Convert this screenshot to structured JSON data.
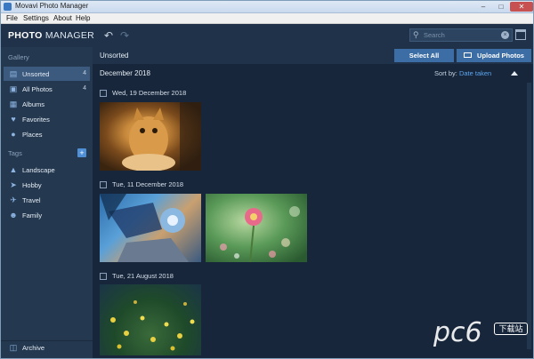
{
  "window": {
    "title": "Movavi Photo Manager"
  },
  "menu": {
    "file": "File",
    "settings": "Settings",
    "about": "About",
    "help": "Help"
  },
  "header": {
    "logo_bold": "PHOTO",
    "logo_thin": "MANAGER",
    "undo_icon": "undo-arrow",
    "redo_icon": "redo-arrow",
    "search_placeholder": "Search"
  },
  "sidebar": {
    "gallery_heading": "Gallery",
    "items": [
      {
        "label": "Unsorted",
        "count": "4",
        "icon": "inbox-icon"
      },
      {
        "label": "All Photos",
        "count": "4",
        "icon": "photos-icon"
      },
      {
        "label": "Albums",
        "count": "",
        "icon": "albums-icon"
      },
      {
        "label": "Favorites",
        "count": "",
        "icon": "heart-icon"
      },
      {
        "label": "Places",
        "count": "",
        "icon": "pin-icon"
      }
    ],
    "tags_heading": "Tags",
    "tags": [
      {
        "label": "Landscape",
        "icon": "landscape-icon"
      },
      {
        "label": "Hobby",
        "icon": "bird-icon"
      },
      {
        "label": "Travel",
        "icon": "plane-icon"
      },
      {
        "label": "Family",
        "icon": "family-icon"
      }
    ],
    "archive": "Archive"
  },
  "main": {
    "breadcrumb": "Unsorted",
    "select_all": "Select All",
    "upload": "Upload Photos",
    "month": "December 2018",
    "sort_label": "Sort by:",
    "sort_value": "Date taken",
    "groups": [
      {
        "date": "Wed, 19 December 2018"
      },
      {
        "date": "Tue, 11 December 2018"
      },
      {
        "date": "Tue, 21 August 2018"
      }
    ]
  },
  "watermark": {
    "text": "pc6",
    "badge": "下载站"
  },
  "colors": {
    "accent": "#3c6da5",
    "sidebar": "#243850",
    "content": "#17263a",
    "link": "#5ca6f0"
  }
}
